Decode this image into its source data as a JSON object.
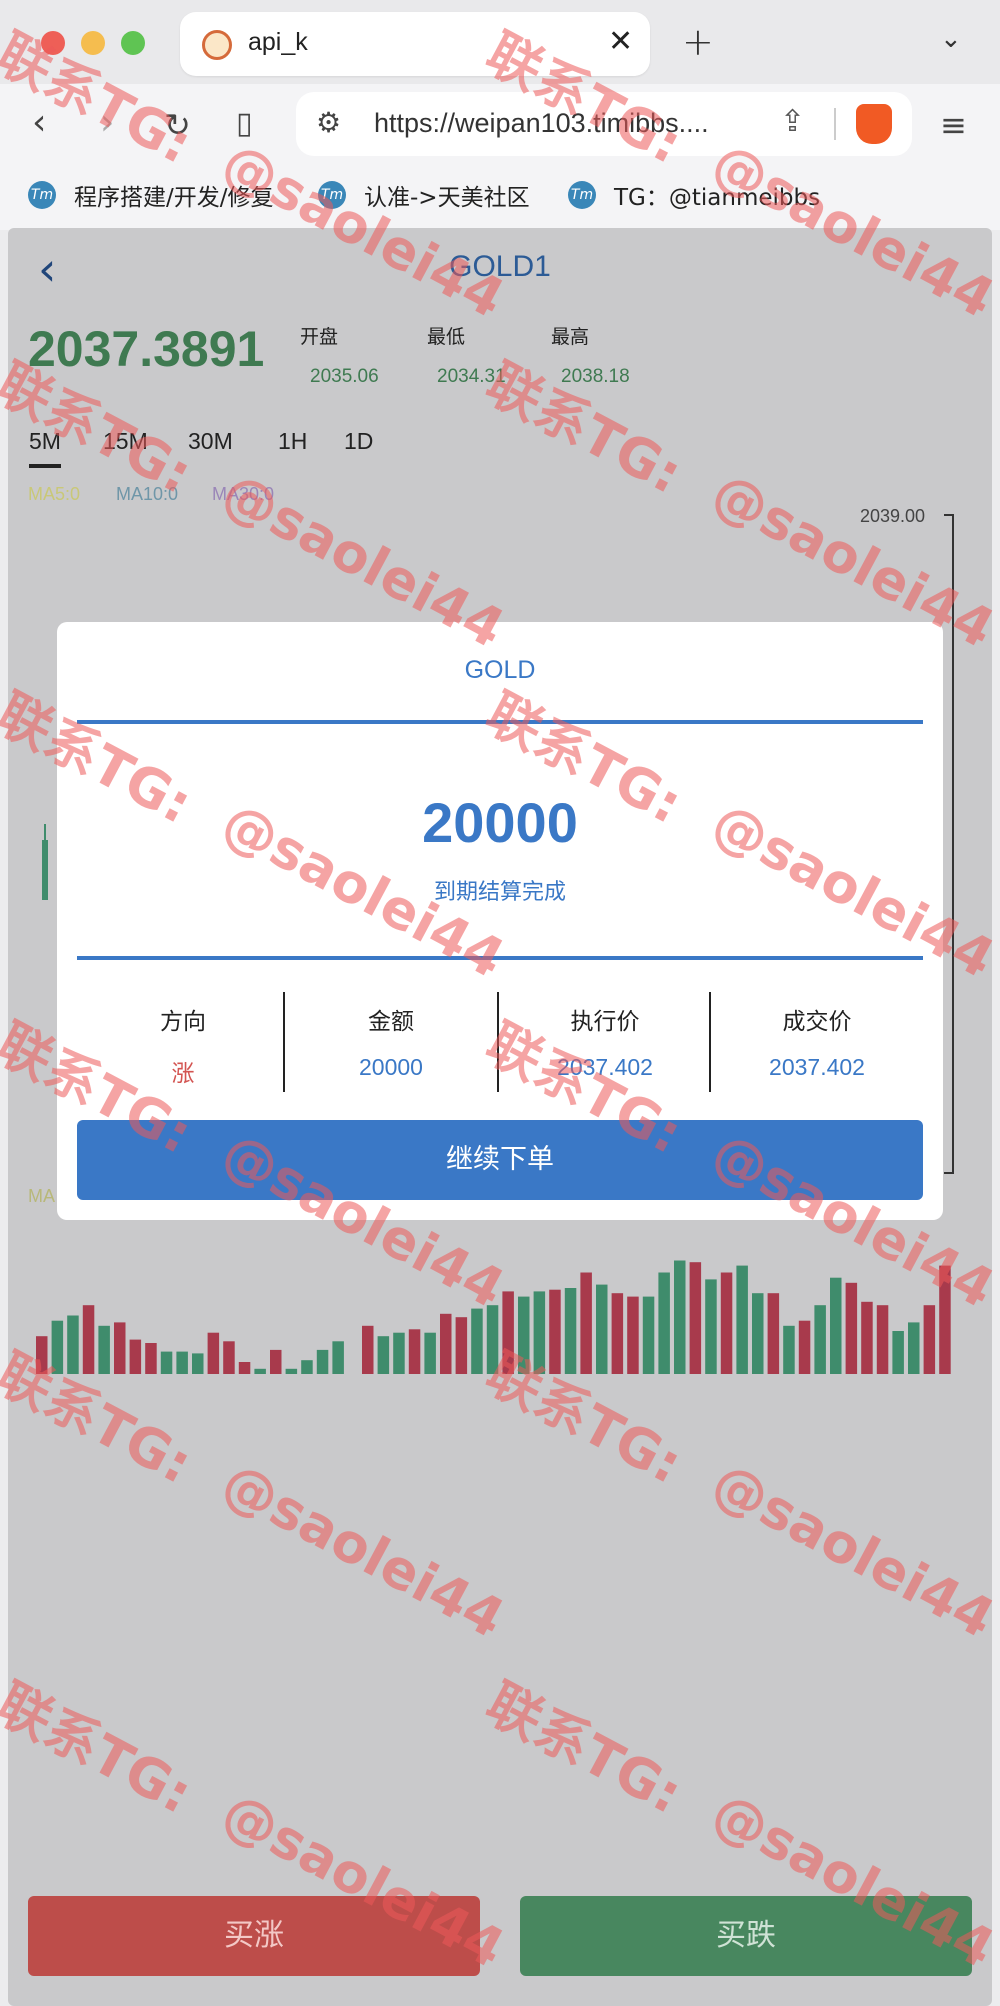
{
  "browser": {
    "tab_title": "api_k",
    "url": "https://weipan103.timibbs....",
    "bookmarks": [
      "程序搭建/开发/修复",
      "认准->天美社区",
      "TG：@tianmeibbs"
    ]
  },
  "header": {
    "back": "‹",
    "title": "GOLD1"
  },
  "quote": {
    "price": "2037.3891",
    "stats": [
      {
        "label": "开盘",
        "value": "2035.06"
      },
      {
        "label": "最低",
        "value": "2034.31"
      },
      {
        "label": "最高",
        "value": "2038.18"
      }
    ]
  },
  "periods": [
    "5M",
    "15M",
    "30M",
    "1H",
    "1D"
  ],
  "active_period": "5M",
  "ma_labels": [
    "MA5:0",
    "MA10:0",
    "MA30:0"
  ],
  "ma_volume_label": "MA",
  "axis": {
    "top_label": "2039.00"
  },
  "actions": {
    "buy_up": "买涨",
    "buy_down": "买跌"
  },
  "modal": {
    "title": "GOLD",
    "amount": "20000",
    "status": "到期结算完成",
    "columns": [
      {
        "head": "方向",
        "value": "涨"
      },
      {
        "head": "金额",
        "value": "20000"
      },
      {
        "head": "执行价",
        "value": "2037.402"
      },
      {
        "head": "成交价",
        "value": "2037.402"
      }
    ],
    "continue": "继续下单"
  },
  "volume_bars": [
    {
      "v": 0.44,
      "up": false
    },
    {
      "v": 0.62,
      "up": true
    },
    {
      "v": 0.68,
      "up": true
    },
    {
      "v": 0.8,
      "up": false
    },
    {
      "v": 0.56,
      "up": true
    },
    {
      "v": 0.6,
      "up": false
    },
    {
      "v": 0.4,
      "up": false
    },
    {
      "v": 0.36,
      "up": false
    },
    {
      "v": 0.26,
      "up": true
    },
    {
      "v": 0.26,
      "up": true
    },
    {
      "v": 0.24,
      "up": true
    },
    {
      "v": 0.48,
      "up": false
    },
    {
      "v": 0.38,
      "up": false
    },
    {
      "v": 0.14,
      "up": false
    },
    {
      "v": 0.06,
      "up": true
    },
    {
      "v": 0.28,
      "up": false
    },
    {
      "v": 0.06,
      "up": true
    },
    {
      "v": 0.16,
      "up": true
    },
    {
      "v": 0.28,
      "up": true
    },
    {
      "v": 0.38,
      "up": true
    },
    {
      "v": 0.56,
      "up": false
    },
    {
      "v": 0.44,
      "up": true
    },
    {
      "v": 0.48,
      "up": true
    },
    {
      "v": 0.52,
      "up": false
    },
    {
      "v": 0.48,
      "up": true
    },
    {
      "v": 0.7,
      "up": false
    },
    {
      "v": 0.66,
      "up": false
    },
    {
      "v": 0.76,
      "up": true
    },
    {
      "v": 0.8,
      "up": true
    },
    {
      "v": 0.96,
      "up": false
    },
    {
      "v": 0.9,
      "up": true
    },
    {
      "v": 0.96,
      "up": true
    },
    {
      "v": 0.98,
      "up": false
    },
    {
      "v": 1.0,
      "up": true
    },
    {
      "v": 1.18,
      "up": false
    },
    {
      "v": 1.04,
      "up": true
    },
    {
      "v": 0.94,
      "up": false
    },
    {
      "v": 0.9,
      "up": false
    },
    {
      "v": 0.9,
      "up": true
    },
    {
      "v": 1.18,
      "up": true
    },
    {
      "v": 1.32,
      "up": true
    },
    {
      "v": 1.3,
      "up": false
    },
    {
      "v": 1.1,
      "up": true
    },
    {
      "v": 1.18,
      "up": false
    },
    {
      "v": 1.26,
      "up": true
    },
    {
      "v": 0.94,
      "up": true
    },
    {
      "v": 0.94,
      "up": false
    },
    {
      "v": 0.56,
      "up": true
    },
    {
      "v": 0.62,
      "up": false
    },
    {
      "v": 0.8,
      "up": true
    },
    {
      "v": 1.12,
      "up": true
    },
    {
      "v": 1.06,
      "up": false
    },
    {
      "v": 0.84,
      "up": false
    },
    {
      "v": 0.8,
      "up": false
    },
    {
      "v": 0.5,
      "up": true
    },
    {
      "v": 0.6,
      "up": true
    },
    {
      "v": 0.8,
      "up": false
    },
    {
      "v": 1.26,
      "up": false
    }
  ],
  "watermark": {
    "line1": "联系TG:",
    "line2": "@saolei44"
  },
  "colors": {
    "up": "#a83a4c",
    "down": "#3f8c6c",
    "accent": "#3a78c6"
  }
}
